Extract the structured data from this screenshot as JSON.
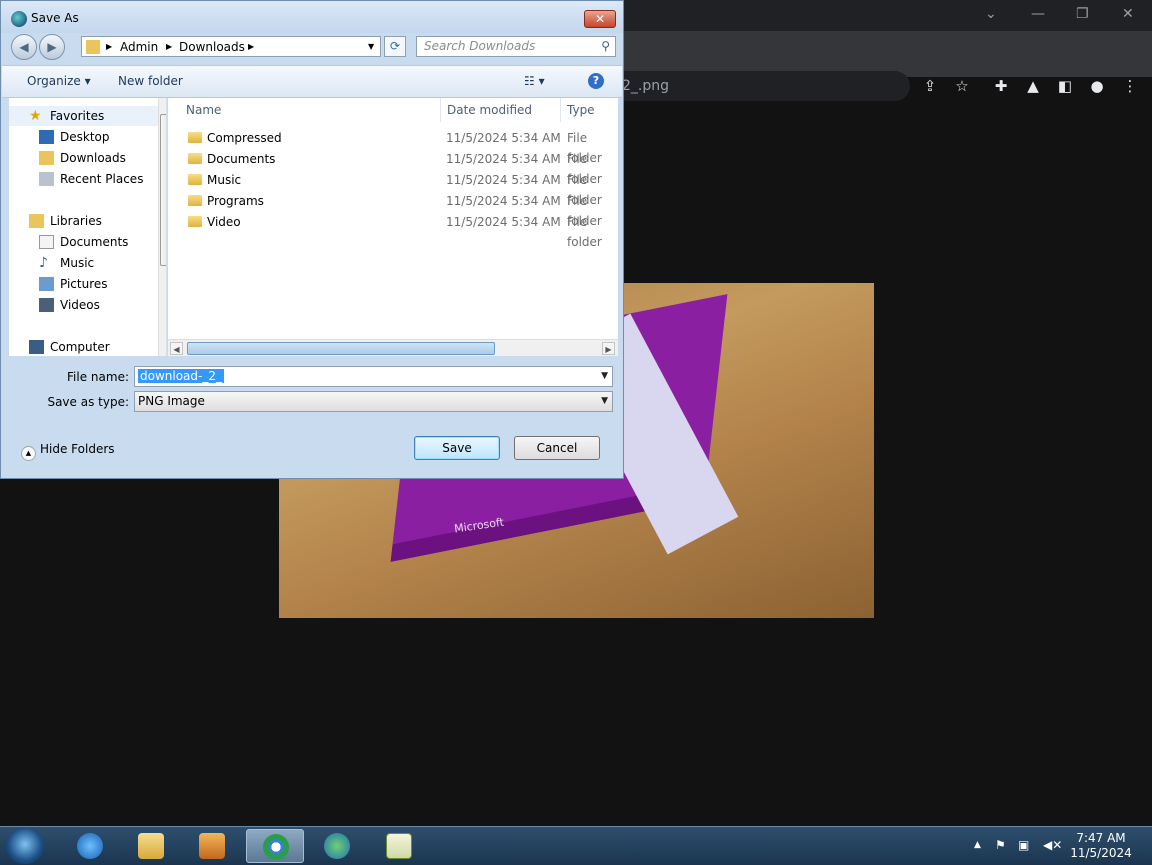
{
  "browser": {
    "tab_fragment": "2_.png",
    "window_controls": [
      "chevron-down-icon",
      "minimize-icon",
      "restore-icon",
      "close-icon"
    ],
    "toolbar_icons": [
      "share-icon",
      "star-icon",
      "extensions-icon",
      "labs-icon",
      "side-panel-icon",
      "profile-icon",
      "menu-icon"
    ],
    "image_text": "Microsoft"
  },
  "dialog": {
    "title": "Save As",
    "close_glyph": "✕",
    "breadcrumb": [
      "Admin",
      "Downloads"
    ],
    "search_placeholder": "Search Downloads",
    "toolbar": {
      "organize": "Organize ▾",
      "new_folder": "New folder"
    },
    "nav": {
      "favorites": "Favorites",
      "favorites_items": [
        "Desktop",
        "Downloads",
        "Recent Places"
      ],
      "libraries": "Libraries",
      "libraries_items": [
        "Documents",
        "Music",
        "Pictures",
        "Videos"
      ],
      "computer": "Computer"
    },
    "columns": {
      "name": "Name",
      "date": "Date modified",
      "type": "Type"
    },
    "files": [
      {
        "name": "Compressed",
        "date": "11/5/2024 5:34 AM",
        "type": "File folder"
      },
      {
        "name": "Documents",
        "date": "11/5/2024 5:34 AM",
        "type": "File folder"
      },
      {
        "name": "Music",
        "date": "11/5/2024 5:34 AM",
        "type": "File folder"
      },
      {
        "name": "Programs",
        "date": "11/5/2024 5:34 AM",
        "type": "File folder"
      },
      {
        "name": "Video",
        "date": "11/5/2024 5:34 AM",
        "type": "File folder"
      }
    ],
    "file_name_label": "File name:",
    "file_name_value": "download-_2_",
    "save_type_label": "Save as type:",
    "save_type_value": "PNG Image",
    "hide_folders": "Hide Folders",
    "save": "Save",
    "cancel": "Cancel"
  },
  "taskbar": {
    "apps": [
      "internet-explorer",
      "file-explorer",
      "media-player",
      "chrome",
      "download-manager",
      "notepad-chart"
    ],
    "clock_time": "7:47 AM",
    "clock_date": "11/5/2024"
  }
}
